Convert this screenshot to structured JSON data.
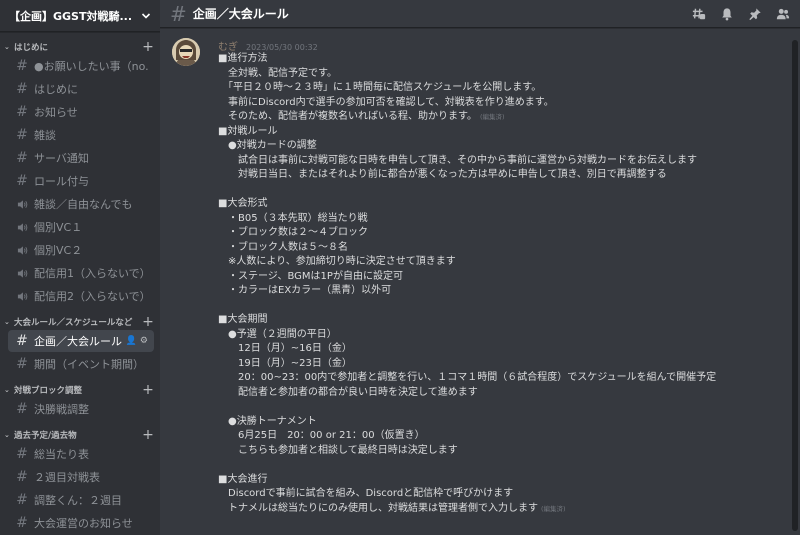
{
  "server": {
    "name": "【企画】GGST対戦騎..."
  },
  "categories": [
    {
      "label": "はじめに",
      "channels": [
        {
          "label": "●お願いしたい事（no...",
          "type": "text"
        },
        {
          "label": "はじめに",
          "type": "text"
        },
        {
          "label": "お知らせ",
          "type": "text"
        },
        {
          "label": "雑談",
          "type": "text"
        },
        {
          "label": "サーバ通知",
          "type": "text"
        },
        {
          "label": "ロール付与",
          "type": "text"
        },
        {
          "label": "雑談／自由なんでも",
          "type": "voice"
        },
        {
          "label": "個別VC１",
          "type": "voice"
        },
        {
          "label": "個別VC２",
          "type": "voice"
        },
        {
          "label": "配信用1（入らないで）",
          "type": "voice"
        },
        {
          "label": "配信用2（入らないで）",
          "type": "voice"
        }
      ]
    },
    {
      "label": "大会ルール／スケジュールなど",
      "channels": [
        {
          "label": "企画／大会ルール",
          "type": "text",
          "active": true
        },
        {
          "label": "期間（イベント期間）",
          "type": "text"
        }
      ]
    },
    {
      "label": "対戦ブロック調整",
      "channels": [
        {
          "label": "決勝戦調整",
          "type": "text"
        }
      ]
    },
    {
      "label": "過去予定/過去物",
      "channels": [
        {
          "label": "総当たり表",
          "type": "text"
        },
        {
          "label": "２週目対戦表",
          "type": "text"
        },
        {
          "label": "調整くん：２週目",
          "type": "text"
        },
        {
          "label": "大会運営のお知らせ",
          "type": "text"
        }
      ]
    }
  ],
  "channel_header": {
    "title": "企画／大会ルール"
  },
  "toolbar_icons": [
    "threads-icon",
    "bell-icon",
    "pin-icon",
    "members-icon"
  ],
  "message": {
    "author": "むぎ",
    "timestamp": "2023/05/30 00:32",
    "edited_label": "(編集済)",
    "lines": [
      "■進行方法",
      "　全対戦、配信予定です。",
      "　「平日２０時～２３時」に１時間毎に配信スケジュールを公開します。",
      "　事前にDiscord内で選手の参加可否を確認して、対戦表を作り進めます。",
      "　そのため、配信者が複数名いればいる程、助かります。",
      "■対戦ルール",
      "　●対戦カードの調整",
      "　　試合日は事前に対戦可能な日時を申告して頂き、その中から事前に運営から対戦カードをお伝えします",
      "　　対戦日当日、またはそれより前に都合が悪くなった方は早めに申告して頂き、別日で再調整する",
      "",
      "■大会形式",
      "　・B05（３本先取）総当たり戦",
      "　・ブロック数は２～４ブロック",
      "　・ブロック人数は５～８名",
      "　※人数により、参加締切り時に決定させて頂きます",
      "　・ステージ、BGMは1Pが自由に設定可",
      "　・カラーはEXカラー（黒青）以外可",
      "",
      "■大会期間",
      "　●予選（２週間の平日）",
      "　　12日（月）~16日（金）",
      "　　19日（月）~23日（金）",
      "　　20：00~23：00内で参加者と調整を行い、１コマ１時間（６試合程度）でスケジュールを組んで開催予定",
      "　　配信者と参加者の都合が良い日時を決定して進めます",
      "",
      "　●決勝トーナメント",
      "　　6月25日　20：00 or 21：00（仮置き）",
      "　　こちらも参加者と相談して最終日時は決定します",
      "",
      "■大会進行",
      "　Discordで事前に試合を組み、Discordと配信枠で呼びかけます",
      "　トナメルは総当たりにのみ使用し、対戦結果は管理者側で入力します"
    ],
    "edited_after_line": [
      4,
      31
    ]
  }
}
